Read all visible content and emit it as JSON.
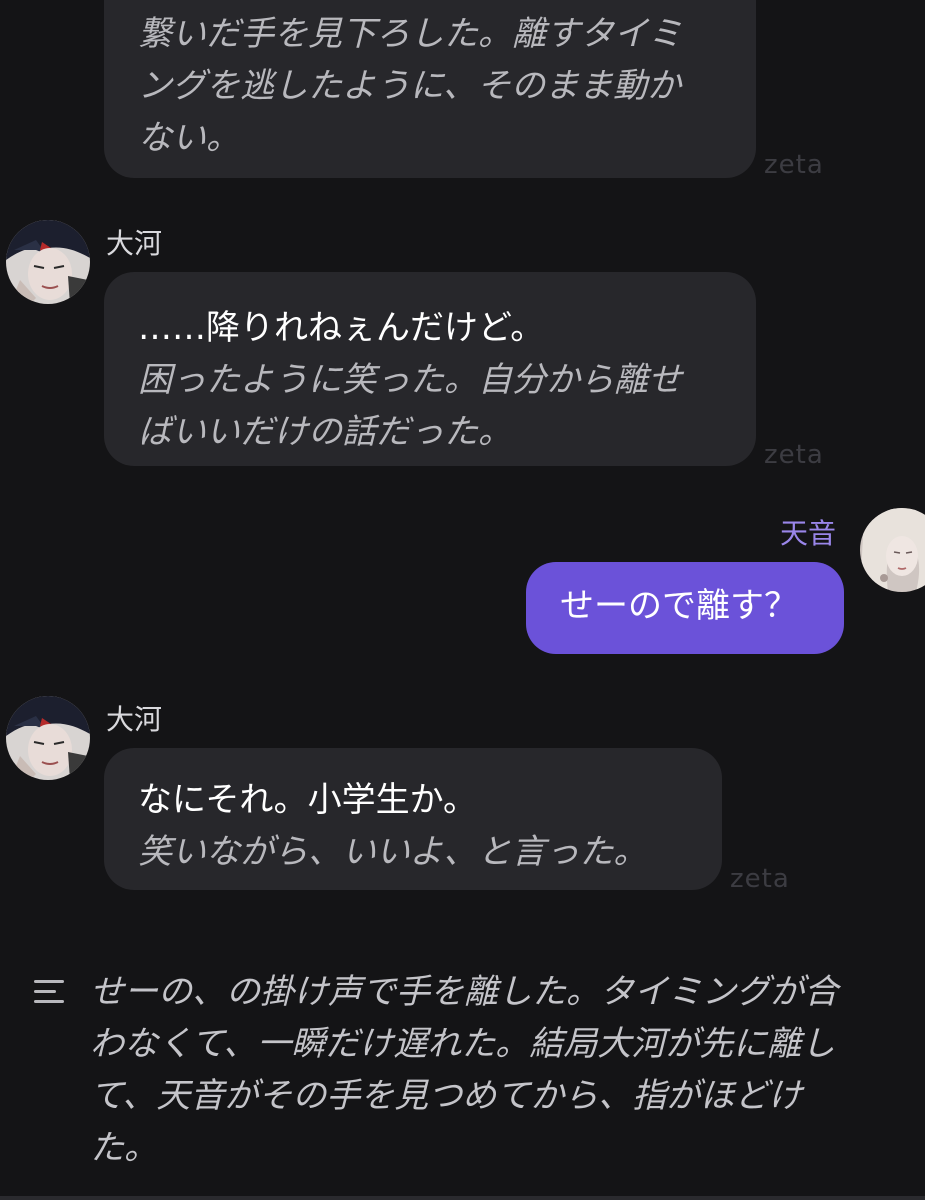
{
  "messages": [
    {
      "lines": [
        "繋いだ手を見下ろした。離すタイミ",
        "ングを逃したように、そのまま動か",
        "ない。"
      ],
      "watermark": "zeta"
    },
    {
      "sender": "大河",
      "speech": "……降りれねぇんだけど。",
      "narration_lines": [
        "困ったように笑った。自分から離せ",
        "ばいいだけの話だった。"
      ],
      "watermark": "zeta"
    },
    {
      "sender": "天音",
      "text": "せーので離す？"
    },
    {
      "sender": "大河",
      "speech": "なにそれ。小学生か。",
      "narration_lines": [
        "笑いながら、いいよ、と言った。"
      ],
      "watermark": "zeta"
    }
  ],
  "narration": {
    "lines": [
      "せーの、の掛け声で手を離した。タイミングが合",
      "わなくて、一瞬だけ遅れた。結局大河が先に離し",
      "て、天音がその手を見つめてから、指がほどけ",
      "た。"
    ],
    "icon": "menu-lines-icon"
  },
  "colors": {
    "background": "#141416",
    "bot_bubble": "#27272b",
    "user_bubble": "#6b52d9",
    "user_name": "#9a86ea",
    "narration_text": "#b8b8bd",
    "watermark": "#3c3c42"
  }
}
